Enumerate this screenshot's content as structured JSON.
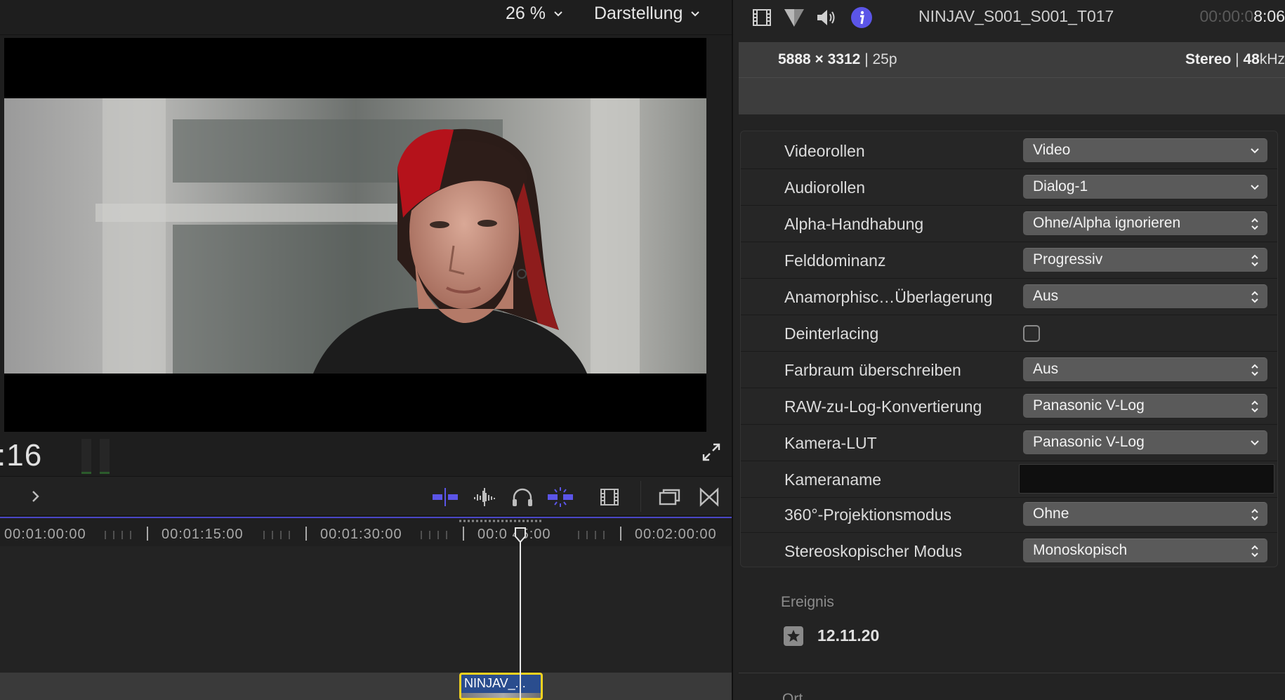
{
  "viewer": {
    "zoom_label": "26 %",
    "display_label": "Darstellung",
    "timecode": ":16"
  },
  "timeline": {
    "ruler_labels": [
      "00:01:00:00",
      "00:01:15:00",
      "00:01:30:00",
      "00:0 45:00",
      "00:02:00:00"
    ],
    "clip_label": "NINJAV_..."
  },
  "inspector": {
    "clip_name": "NINJAV_S001_S001_T017",
    "duration_dim": "00:00:0",
    "duration_main": "8:06",
    "resolution": "5888 × 3312",
    "frame_rate": "25p",
    "audio_channels": "Stereo",
    "sample_rate_value": "48",
    "sample_rate_unit": "kHz",
    "settings": [
      {
        "label": "Videorollen",
        "value": "Video",
        "control": "popup"
      },
      {
        "label": "Audiorollen",
        "value": "Dialog-1",
        "control": "popup"
      },
      {
        "label": "Alpha-Handhabung",
        "value": "Ohne/Alpha ignorieren",
        "control": "stepper"
      },
      {
        "label": "Felddominanz",
        "value": "Progressiv",
        "control": "stepper"
      },
      {
        "label": "Anamorphisc…Überlagerung",
        "value": "Aus",
        "control": "stepper"
      },
      {
        "label": "Deinterlacing",
        "value": "",
        "control": "checkbox"
      },
      {
        "label": "Farbraum überschreiben",
        "value": "Aus",
        "control": "stepper"
      },
      {
        "label": "RAW-zu-Log-Konvertierung",
        "value": "Panasonic V-Log",
        "control": "stepper"
      },
      {
        "label": "Kamera-LUT",
        "value": "Panasonic V-Log",
        "control": "popup"
      },
      {
        "label": "Kameraname",
        "value": "",
        "control": "text"
      },
      {
        "label": "360°-Projektionsmodus",
        "value": "Ohne",
        "control": "stepper"
      },
      {
        "label": "Stereoskopischer Modus",
        "value": "Monoskopisch",
        "control": "stepper"
      }
    ],
    "event_heading": "Ereignis",
    "event_date": "12.11.20",
    "cut_heading": "Ort"
  },
  "colors": {
    "accent": "#4a46c6",
    "clip_selection": "#f4d21f",
    "info_tab_active": "#5b55e8"
  }
}
